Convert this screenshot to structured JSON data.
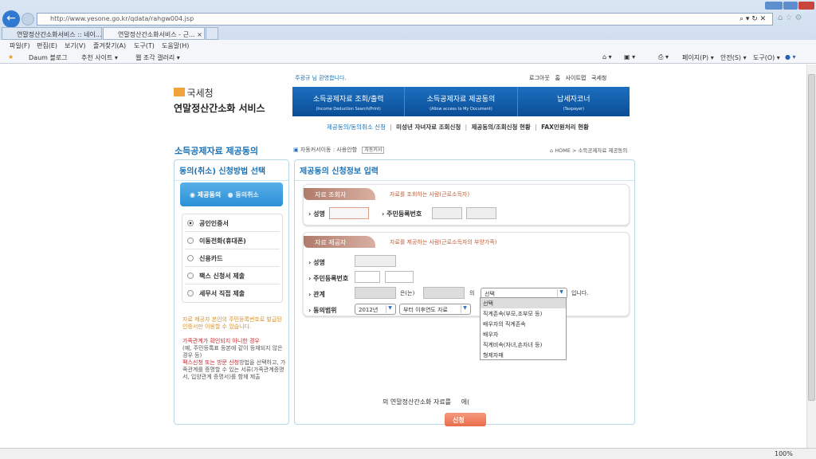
{
  "browser": {
    "url": "http://www.yesone.go.kr/qdata/rahgw004.jsp",
    "tabs": [
      "연말정산간소화서비스 :: 네이...",
      "연말정산간소화서비스 - 근..."
    ],
    "menu": [
      "파일(F)",
      "편집(E)",
      "보기(V)",
      "즐겨찾기(A)",
      "도구(T)",
      "도움말(H)"
    ],
    "favorites": [
      "Daum 블로그",
      "추천 사이트 ▾",
      "웹 조각 갤러리 ▾"
    ],
    "commands": [
      "페이지(P) ▾",
      "안전(S) ▾",
      "도구(O) ▾"
    ],
    "zoom": "100%"
  },
  "header": {
    "agency": "국세청",
    "service": "연말정산간소화 서비스",
    "welcome": "주광규 님 환영합니다.",
    "links": [
      "로그아웃",
      "홈",
      "사이트맵",
      "국세청"
    ],
    "nav": [
      {
        "label": "소득공제자료 조회/출력",
        "sub": "(Income Deduction Search/Print)"
      },
      {
        "label": "소득공제자료 제공동의",
        "sub": "(Allow access to My Document)"
      },
      {
        "label": "납세자코너",
        "sub": "(Taxpayer)"
      }
    ],
    "subnav": [
      "제공동의/동의취소 신청",
      "미성년 자녀자료 조회신청",
      "제공동의/조회신청 현황",
      "FAX민원처리 현황"
    ]
  },
  "page": {
    "title": "소득공제자료 제공동의",
    "auto_cursor": "자동커서이동 : 사용안함",
    "auto_cursor_btn": "자동커서",
    "breadcrumb": "HOME > 소득공제자료 제공동의"
  },
  "left": {
    "title": "동의(취소) 신청방법 선택",
    "tabs": [
      "제공동의",
      "동의취소"
    ],
    "methods": [
      "공인인증서",
      "이동전화(휴대폰)",
      "신용카드",
      "팩스 신청서 제출",
      "세무서 직접 제출"
    ],
    "note1": "자료 제공자 본인의 주민등록번호로 발급된 인증서만 이용할 수 있습니다.",
    "note2_red": "가족관계가 확인되지 아니한 경우",
    "note2": "(예, 주민등록표 등본에 같이 등재되지 않은 경우 등)",
    "note3_red": "팩스신청 또는 방문 신청",
    "note3": "방법을 선택하고, 가족관계를 증명할 수 있는 서류(가족관계증명서, 입양관계 증명서)를 함께 제출"
  },
  "form": {
    "title": "제공동의 신청정보 입력",
    "viewer": {
      "tag": "자료 조회자",
      "desc": "자료를 조회하는 사람(근로소득자)",
      "name_label": "성명",
      "rrn_label": "주민등록번호"
    },
    "provider": {
      "tag": "자료 제공자",
      "desc": "자료를 제공하는 사람(근로소득자의 부양가족)",
      "name_label": "성명",
      "rrn_label": "주민등록번호",
      "relation_label": "관계",
      "eun": "은(는)",
      "ui": "의",
      "imnida": "입니다.",
      "range_label": "동의범위",
      "year": "2012년",
      "range": "부터 이후연도 자료"
    },
    "relation_selected": "선택",
    "relation_options": [
      "선택",
      "직계존속(부모,조부모 등)",
      "배우자의 직계존속",
      "배우자",
      "직계비속(자녀,손자녀 등)",
      "형제자매"
    ],
    "sentence": "의 연말정산간소화 자료를",
    "sentence2": "에(",
    "submit": "신청"
  }
}
